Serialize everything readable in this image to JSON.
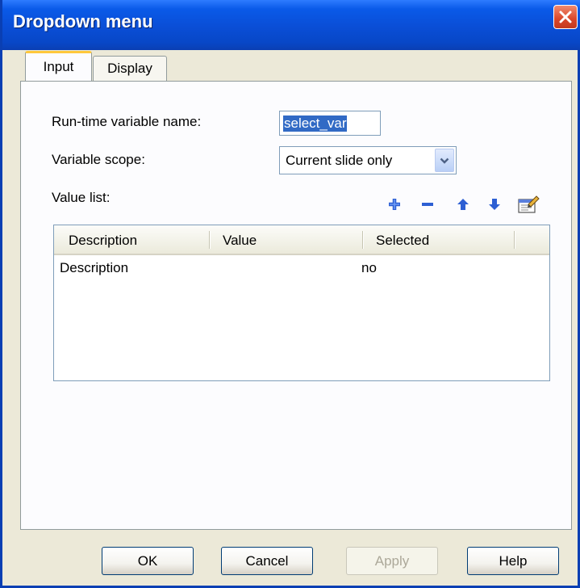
{
  "window": {
    "title": "Dropdown menu"
  },
  "tabs": [
    {
      "label": "Input",
      "active": true
    },
    {
      "label": "Display",
      "active": false
    }
  ],
  "form": {
    "var_name_label": "Run-time variable name:",
    "var_name_value": "select_var",
    "scope_label": "Variable scope:",
    "scope_value": "Current slide only",
    "value_list_label": "Value list:"
  },
  "toolbar": {
    "icons": [
      "add-icon",
      "remove-icon",
      "move-up-icon",
      "move-down-icon",
      "properties-icon"
    ]
  },
  "table": {
    "columns": [
      "Description",
      "Value",
      "Selected"
    ],
    "rows": [
      {
        "description": "Description",
        "value": "",
        "selected": "no"
      }
    ]
  },
  "buttons": {
    "ok": "OK",
    "cancel": "Cancel",
    "apply": "Apply",
    "help": "Help"
  },
  "colors": {
    "title_bar": "#0A4FD8",
    "close_button": "#D9462A",
    "selection": "#316AC5",
    "active_tab_accent": "#FFC83C"
  }
}
